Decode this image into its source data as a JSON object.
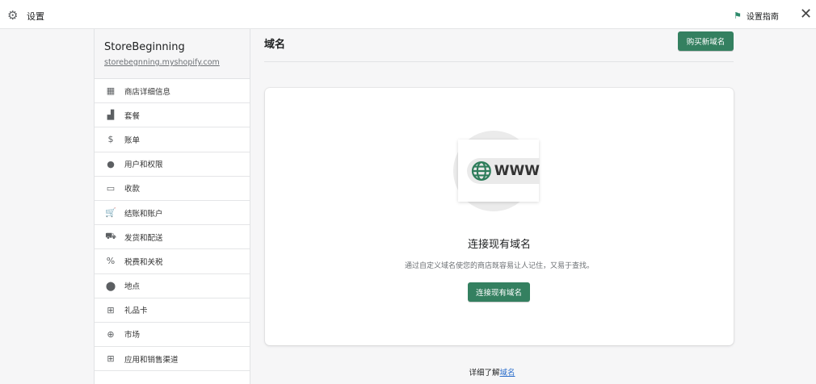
{
  "topbar": {
    "title": "设置",
    "guide": "设置指南"
  },
  "store": {
    "name": "StoreBeginning",
    "url": "storebegnning.myshopify.com"
  },
  "sidebar": {
    "items": [
      {
        "label": "商店详细信息",
        "icon": "store-icon",
        "glyph": "▦"
      },
      {
        "label": "套餐",
        "icon": "plan-icon",
        "glyph": "▟"
      },
      {
        "label": "账单",
        "icon": "billing-icon",
        "glyph": "$"
      },
      {
        "label": "用户和权限",
        "icon": "user-icon",
        "glyph": "●"
      },
      {
        "label": "收款",
        "icon": "payments-icon",
        "glyph": "▭"
      },
      {
        "label": "结账和账户",
        "icon": "cart-icon",
        "glyph": "🛒"
      },
      {
        "label": "发货和配送",
        "icon": "truck-icon",
        "glyph": "⛟"
      },
      {
        "label": "税费和关税",
        "icon": "tax-icon",
        "glyph": "%"
      },
      {
        "label": "地点",
        "icon": "location-icon",
        "glyph": "⬤"
      },
      {
        "label": "礼品卡",
        "icon": "gift-icon",
        "glyph": "⊞"
      },
      {
        "label": "市场",
        "icon": "globe-icon",
        "glyph": "⊕"
      },
      {
        "label": "应用和销售渠道",
        "icon": "apps-icon",
        "glyph": "⊞"
      }
    ]
  },
  "main": {
    "title": "域名",
    "buy_button": "购买新域名",
    "illustration_text": "WWW",
    "card_title": "连接现有域名",
    "card_desc": "通过自定义域名使您的商店既容易让人记住，又易于查找。",
    "connect_button": "连接现有域名",
    "learn_prefix": "详细了解",
    "learn_link": "域名"
  },
  "colors": {
    "primary": "#348060",
    "link": "#2c6ecb"
  }
}
